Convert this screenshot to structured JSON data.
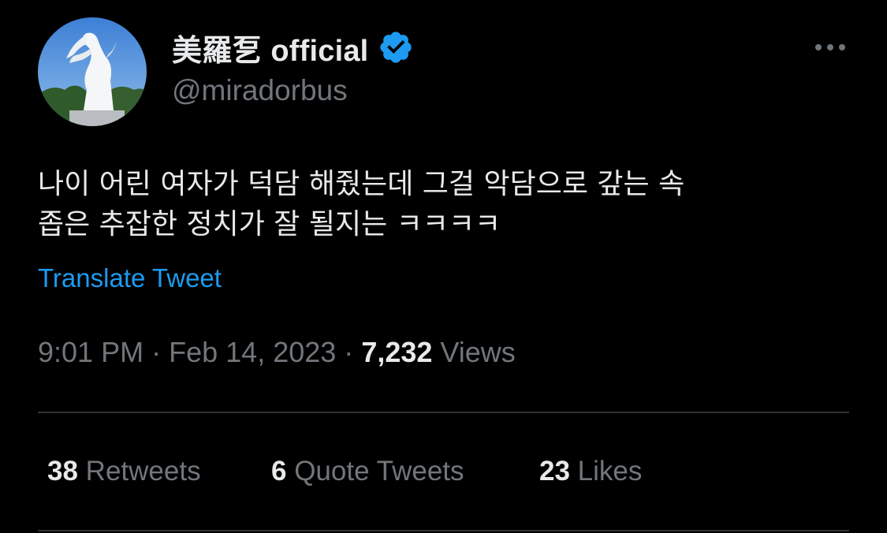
{
  "author": {
    "display_name": "美羅乭 official",
    "handle": "@miradorbus",
    "verified": true,
    "avatar": "white-horse-statue-avatar"
  },
  "tweet": {
    "text": "나이 어린 여자가 덕담 해줬는데 그걸 악담으로 갚는 속\n좁은 추잡한 정치가 잘 될지는 ㅋㅋㅋㅋ",
    "translate_label": "Translate Tweet",
    "time": "9:01 PM",
    "date": "Feb 14, 2023",
    "separator": "·",
    "views_count": "7,232",
    "views_label": "Views"
  },
  "stats": {
    "retweets": {
      "count": "38",
      "label": "Retweets"
    },
    "quotes": {
      "count": "6",
      "label": "Quote Tweets"
    },
    "likes": {
      "count": "23",
      "label": "Likes"
    }
  },
  "icons": {
    "verified": "verified-badge-icon",
    "more": "more-options-icon"
  },
  "colors": {
    "background": "#000000",
    "text": "#e7e9ea",
    "secondary": "#71767b",
    "accent": "#1d9bf0",
    "divider": "#2f3336"
  }
}
